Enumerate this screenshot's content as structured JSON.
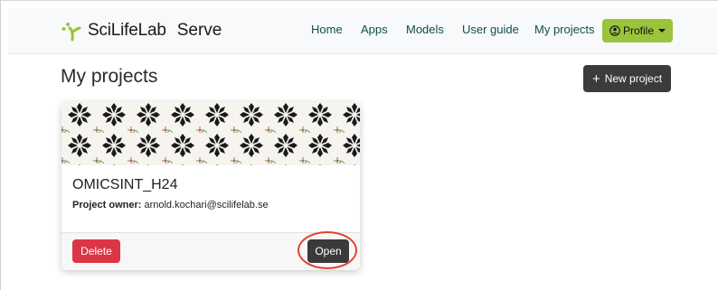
{
  "navbar": {
    "brand": "SciLifeLab",
    "app_name": "Serve",
    "links": [
      {
        "label": "Home"
      },
      {
        "label": "Apps"
      },
      {
        "label": "Models"
      },
      {
        "label": "User guide"
      },
      {
        "label": "My projects"
      }
    ],
    "profile_label": "Profile",
    "profile_icon": "user-circle-icon",
    "colors": {
      "brand_green": "#9bc33b",
      "link": "#0d4f4f"
    }
  },
  "page": {
    "title": "My projects",
    "new_project_label": "New project"
  },
  "projects": [
    {
      "name": "OMICSINT_H24",
      "owner_label": "Project owner:",
      "owner_email": "arnold.kochari@scilifelab.se",
      "delete_label": "Delete",
      "open_label": "Open"
    }
  ],
  "colors": {
    "delete": "#dc3545",
    "dark_button": "#3a3a3a",
    "annotation_circle": "#e2432d"
  }
}
